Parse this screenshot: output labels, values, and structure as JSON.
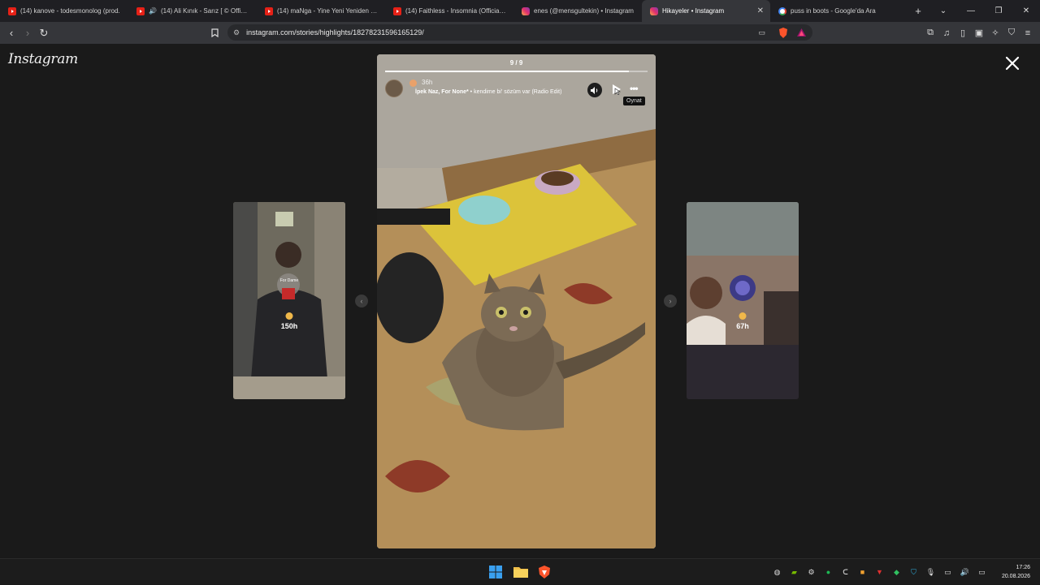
{
  "browser": {
    "tabs": [
      {
        "title": "(14) kanove - todesmonolog (prod.",
        "icon": "youtube-icon",
        "active": false
      },
      {
        "title": "(14) Ali Kınık - Sarız [ © Official",
        "icon": "youtube-icon",
        "active": false,
        "audio": true
      },
      {
        "title": "(14) maNga - Yine Yeni Yeniden (Ye",
        "icon": "youtube-icon",
        "active": false
      },
      {
        "title": "(14) Faithless - Insomnia (Official 4K",
        "icon": "youtube-icon",
        "active": false
      },
      {
        "title": "enes (@mensgultekin) • Instagram",
        "icon": "instagram-icon",
        "active": false
      },
      {
        "title": "Hikayeler • Instagram",
        "icon": "instagram-icon",
        "active": true
      },
      {
        "title": "puss in boots - Google'da Ara",
        "icon": "google-icon",
        "active": false
      }
    ],
    "new_tab": "+",
    "url": "instagram.com/stories/highlights/18278231596165129/"
  },
  "page": {
    "logo": "Instagram",
    "left_card": {
      "time": "150h",
      "sticker_text": "For Dame"
    },
    "right_card": {
      "time": "67h"
    },
    "story": {
      "counter": "9 / 9",
      "progress": 0.93,
      "time": "36h",
      "song_artist": "İpek Naz, For None*",
      "song_title": " • kendime bi' sözüm var (Radio Edit)",
      "tooltip": "Oynat"
    }
  },
  "taskbar": {
    "time": "17:26",
    "date": "20.08.2026"
  },
  "colors": {
    "page_bg": "#1a1a1a",
    "tab_bg": "#1f1f23",
    "toolbar_bg": "#35363a",
    "youtube_red": "#e62117"
  }
}
